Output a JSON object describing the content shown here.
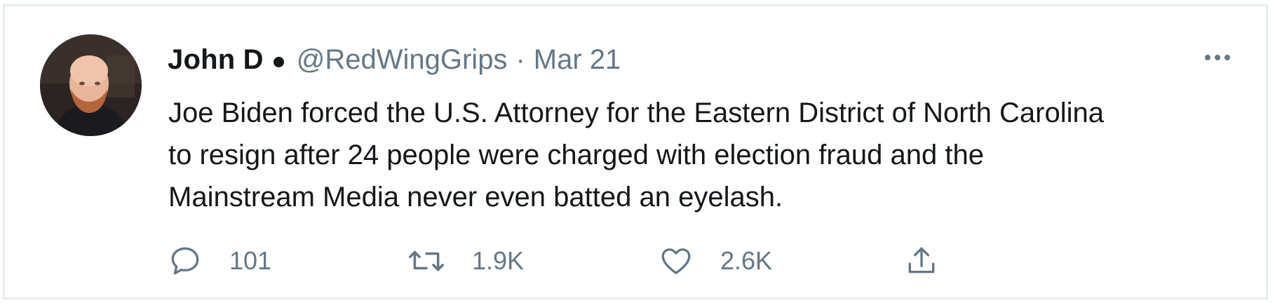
{
  "tweet": {
    "author": {
      "display_name": "John D",
      "handle": "@RedWingGrips"
    },
    "separator": "·",
    "date": "Mar 21",
    "text_lines": [
      "Joe Biden forced the U.S. Attorney for the Eastern District of North Carolina",
      "to resign after 24 people were charged with election fraud and the",
      "Mainstream Media never even batted an eyelash."
    ],
    "actions": {
      "reply_count": "101",
      "retweet_count": "1.9K",
      "like_count": "2.6K"
    }
  },
  "icons": {
    "more": "more-horizontal-icon",
    "reply": "speech-bubble-icon",
    "retweet": "retweet-arrows-icon",
    "like": "heart-icon",
    "share": "share-upload-icon"
  },
  "colors": {
    "text": "#14171a",
    "secondary": "#657786",
    "border": "#e6ecf0",
    "background": "#ffffff"
  }
}
